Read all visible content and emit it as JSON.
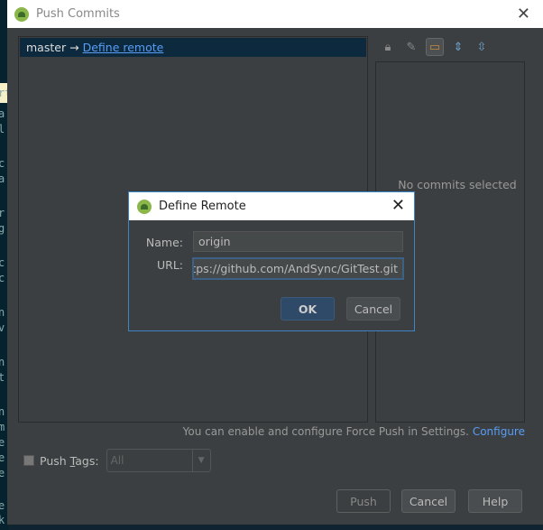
{
  "editor_chars": [
    "rt",
    "a",
    "l",
    "c",
    "a",
    "r",
    "g",
    "c",
    "c",
    "n",
    "v",
    "n",
    "t",
    "n",
    "m",
    "e",
    "e",
    "e",
    "e",
    "k"
  ],
  "window": {
    "title": "Push Commits",
    "close": "✕"
  },
  "commits": {
    "branch": "master",
    "arrow": "→",
    "define_remote": "Define remote"
  },
  "toolbar": [
    "lock-icon",
    "edit-icon",
    "folder-icon",
    "expand-all-icon",
    "collapse-all-icon"
  ],
  "details": {
    "empty": "No commits selected"
  },
  "hint": {
    "text": "You can enable and configure Force Push in Settings.",
    "link": "Configure"
  },
  "push_tags": {
    "label_pre": "Push ",
    "label_u": "T",
    "label_post": "ags:",
    "value": "All",
    "checked": false
  },
  "buttons": {
    "push": "Push",
    "cancel": "Cancel",
    "help": "Help"
  },
  "dialog": {
    "title": "Define Remote",
    "close": "✕",
    "name_label": "Name:",
    "name_value": "origin",
    "url_label": "URL:",
    "url_value": "https://github.com/AndSync/GitTest.git",
    "ok": "OK",
    "cancel": "Cancel"
  }
}
